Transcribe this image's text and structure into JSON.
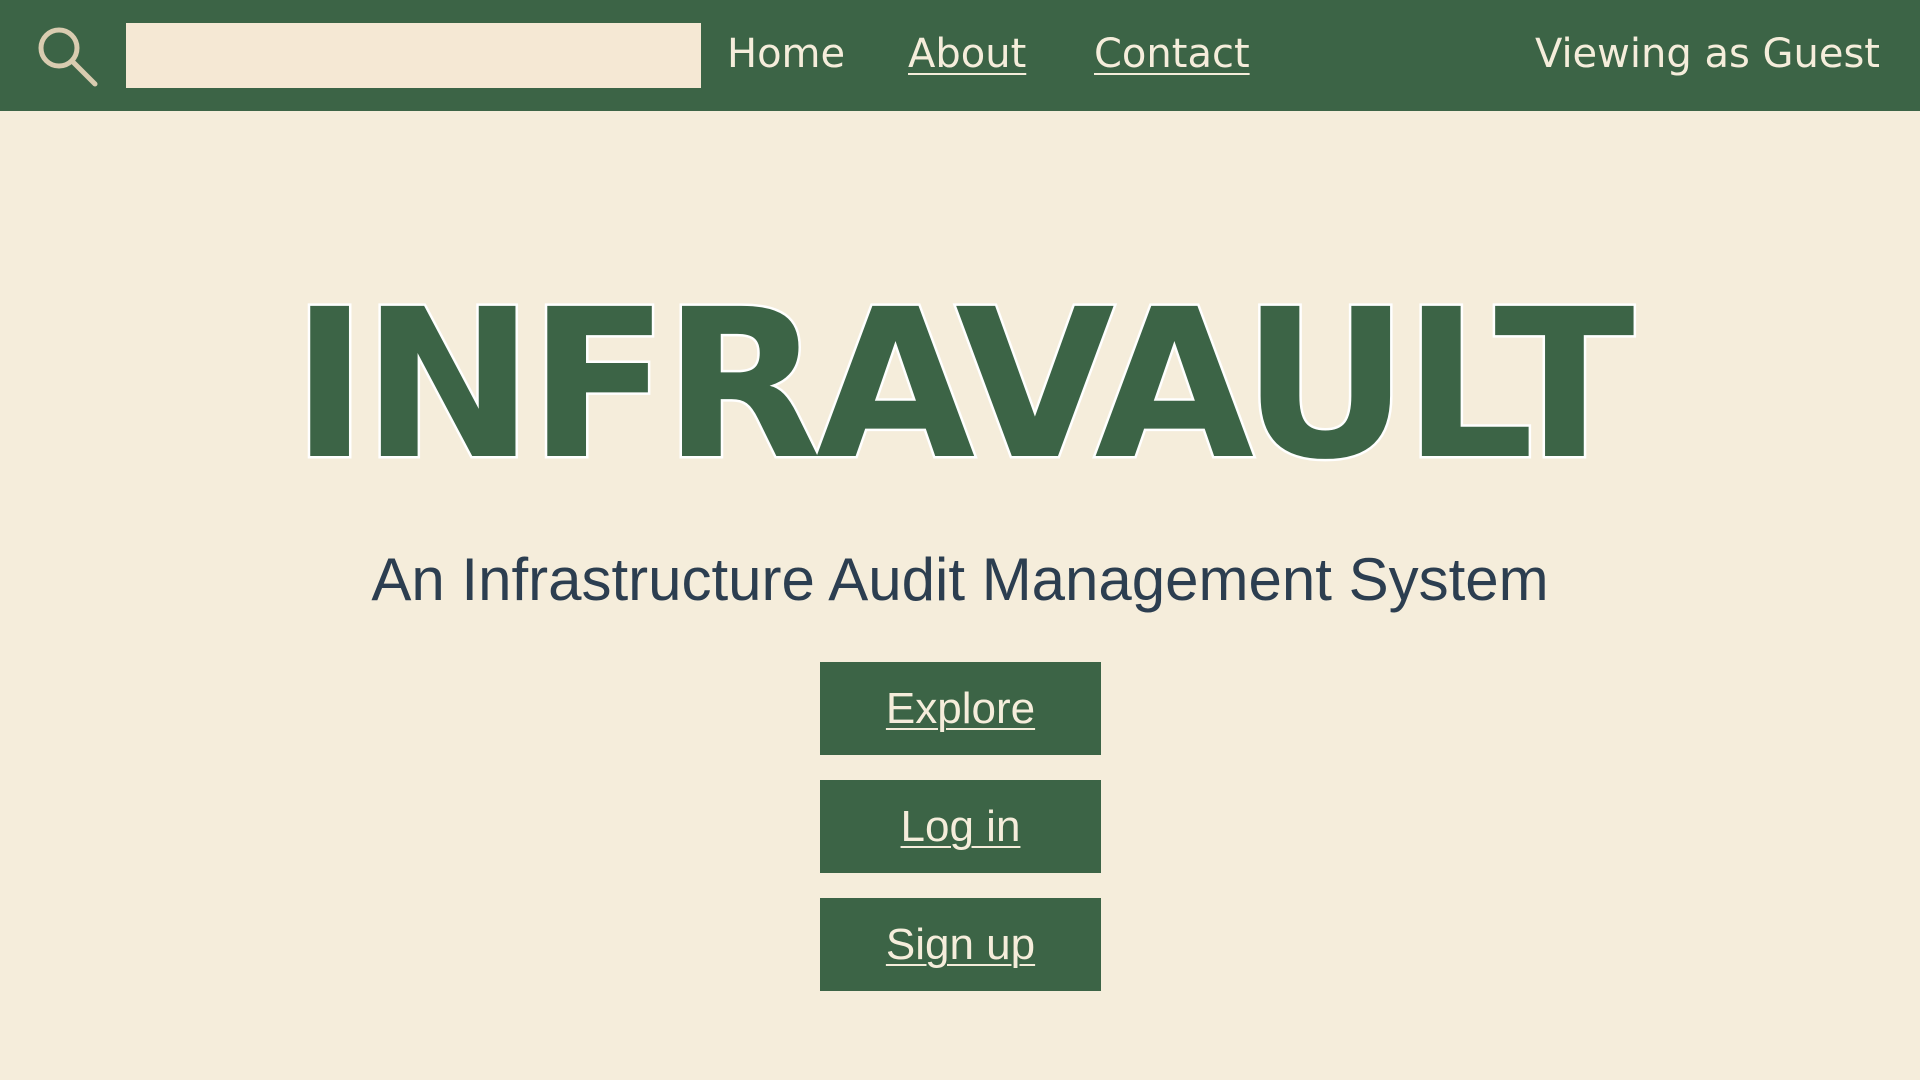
{
  "header": {
    "search": {
      "icon": "search-icon",
      "value": "",
      "placeholder": ""
    },
    "nav": {
      "home": "Home",
      "about": "About",
      "contact": "Contact"
    },
    "viewing_as": "Viewing as Guest"
  },
  "hero": {
    "title": "INFRAVAULT",
    "subtitle": "An Infrastructure Audit Management System"
  },
  "actions": {
    "explore": "Explore",
    "login": "Log in",
    "signup": "Sign up"
  },
  "colors": {
    "primary_green": "#3c6446",
    "background_cream": "#f5eddb",
    "subtitle_text": "#2c3e50"
  }
}
